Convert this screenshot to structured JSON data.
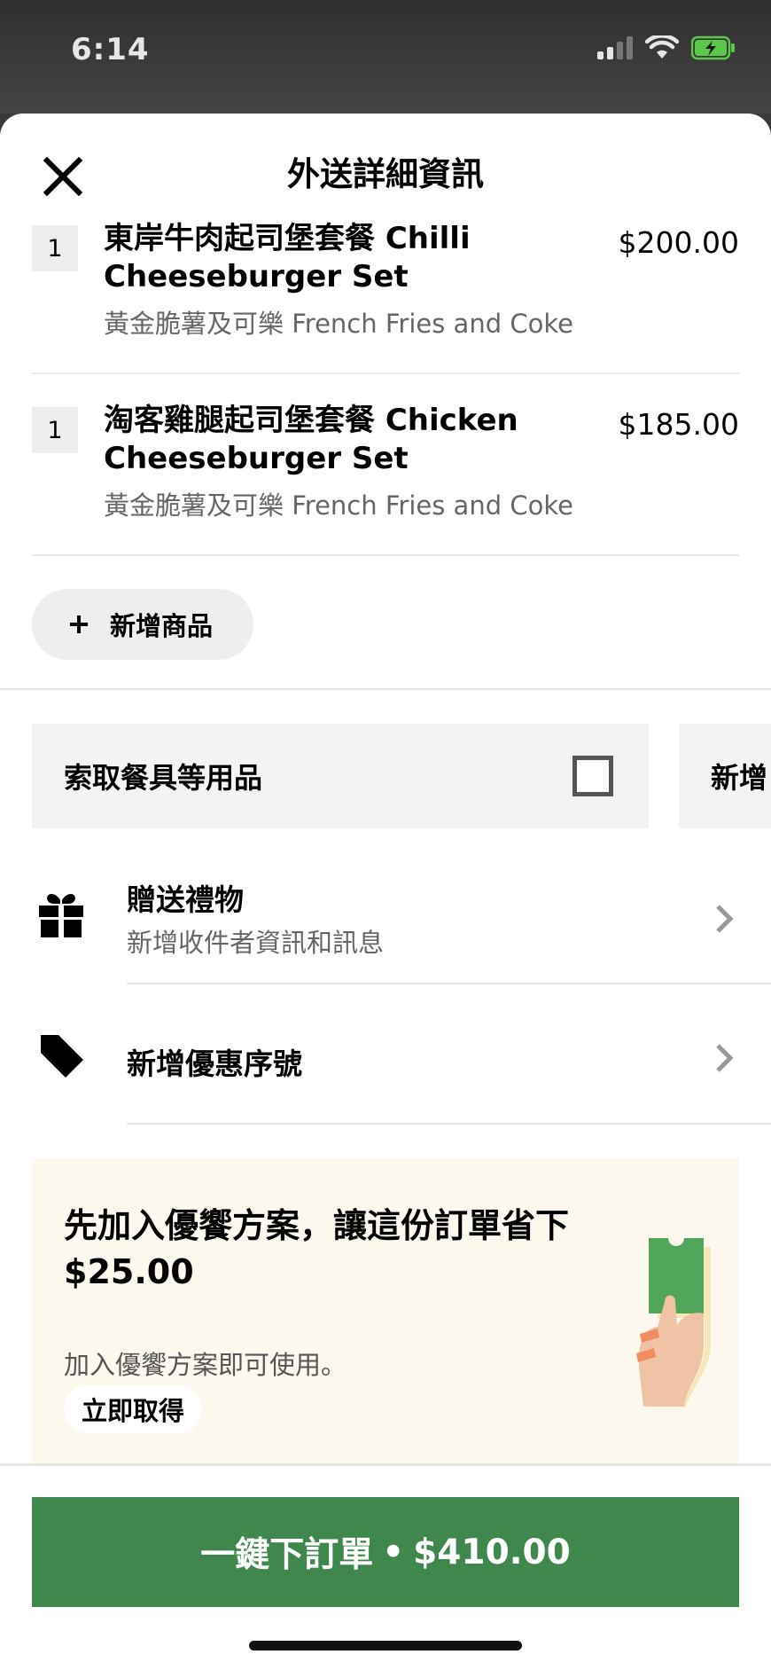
{
  "status": {
    "time": "6:14"
  },
  "header": {
    "title": "外送詳細資訊"
  },
  "cart": {
    "items": [
      {
        "qty": "1",
        "name": "東岸牛肉起司堡套餐 Chilli Cheeseburger Set",
        "option": "黃金脆薯及可樂 French Fries and Coke",
        "price": "$200.00"
      },
      {
        "qty": "1",
        "name": "淘客雞腿起司堡套餐 Chicken Cheeseburger Set",
        "option": "黃金脆薯及可樂 French Fries and Coke",
        "price": "$185.00"
      }
    ],
    "add_item_label": "新增商品"
  },
  "options": {
    "utensils_label": "索取餐具等用品",
    "add_tile_label": "新增"
  },
  "rows": {
    "gift": {
      "title": "贈送禮物",
      "subtitle": "新增收件者資訊和訊息"
    },
    "promo_code": {
      "title": "新增優惠序號"
    }
  },
  "promo": {
    "title": "先加入優饗方案，讓這份訂單省下 $25.00",
    "description": "加入優饗方案即可使用。",
    "button_label": "立即取得"
  },
  "footer": {
    "order_label": "一鍵下訂單",
    "separator": "•",
    "total": "$410.00"
  },
  "colors": {
    "accent": "#3f874c",
    "promo_bg": "#fdf8ee"
  }
}
